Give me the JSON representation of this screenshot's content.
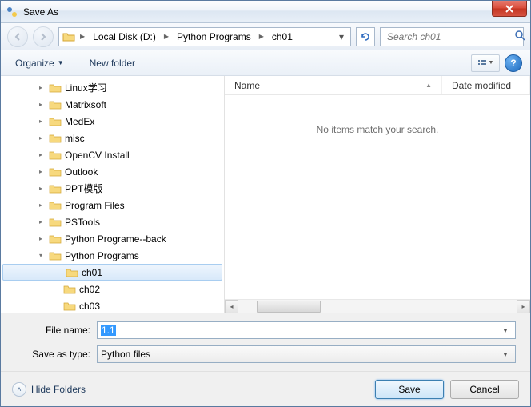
{
  "title": "Save As",
  "breadcrumbs": [
    "Local Disk (D:)",
    "Python Programs",
    "ch01"
  ],
  "search_placeholder": "Search ch01",
  "toolbar": {
    "organize": "Organize",
    "new_folder": "New folder"
  },
  "tree": {
    "items": [
      {
        "label": "Linux学习",
        "indent": 2,
        "expanded": false
      },
      {
        "label": "Matrixsoft",
        "indent": 2,
        "expanded": false
      },
      {
        "label": "MedEx",
        "indent": 2,
        "expanded": false
      },
      {
        "label": "misc",
        "indent": 2,
        "expanded": false
      },
      {
        "label": "OpenCV Install",
        "indent": 2,
        "expanded": false
      },
      {
        "label": "Outlook",
        "indent": 2,
        "expanded": false
      },
      {
        "label": "PPT模版",
        "indent": 2,
        "expanded": false
      },
      {
        "label": "Program Files",
        "indent": 2,
        "expanded": false
      },
      {
        "label": "PSTools",
        "indent": 2,
        "expanded": false
      },
      {
        "label": "Python Programe--back",
        "indent": 2,
        "expanded": false
      },
      {
        "label": "Python Programs",
        "indent": 2,
        "expanded": true
      },
      {
        "label": "ch01",
        "indent": 3,
        "selected": true
      },
      {
        "label": "ch02",
        "indent": 3
      },
      {
        "label": "ch03",
        "indent": 3
      }
    ]
  },
  "list": {
    "cols": {
      "name": "Name",
      "date": "Date modified"
    },
    "empty": "No items match your search."
  },
  "fields": {
    "name_label": "File name:",
    "name_value": "1.1",
    "type_label": "Save as type:",
    "type_value": "Python files"
  },
  "actions": {
    "hide_folders": "Hide Folders",
    "save": "Save",
    "cancel": "Cancel"
  }
}
